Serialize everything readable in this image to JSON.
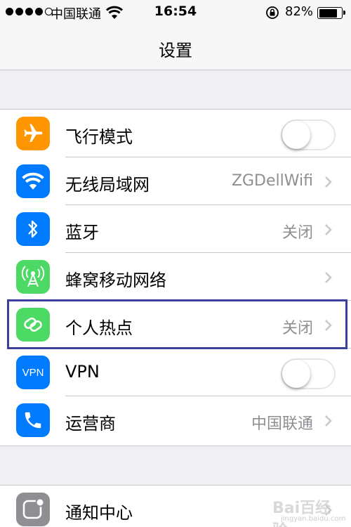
{
  "status": {
    "carrier": "中国联通",
    "time": "16:54",
    "battery_percent": "82%",
    "battery_level": 0.82
  },
  "nav": {
    "title": "设置"
  },
  "rows": [
    {
      "label": "飞行模式",
      "icon": "airplane-icon",
      "color": "#ff9500",
      "control": "toggle",
      "on": false
    },
    {
      "label": "无线局域网",
      "icon": "wifi-icon",
      "color": "#007aff",
      "value": "ZGDellWifi",
      "control": "chevron"
    },
    {
      "label": "蓝牙",
      "icon": "bluetooth-icon",
      "color": "#007aff",
      "value": "关闭",
      "control": "chevron"
    },
    {
      "label": "蜂窝移动网络",
      "icon": "cellular-antenna-icon",
      "color": "#4cd964",
      "control": "chevron"
    },
    {
      "label": "个人热点",
      "icon": "hotspot-chain-icon",
      "color": "#4cd964",
      "value": "关闭",
      "control": "chevron"
    },
    {
      "label": "VPN",
      "icon": "vpn-icon",
      "color": "#007aff",
      "icon_text": "VPN",
      "control": "toggle",
      "on": false
    },
    {
      "label": "运营商",
      "icon": "phone-icon",
      "color": "#007aff",
      "value": "中国联通",
      "control": "chevron"
    },
    {
      "label": "通知中心",
      "icon": "notification-center-icon",
      "color": "#8e8e93",
      "control": "chevron"
    }
  ],
  "watermark": {
    "text": "Bai百经验",
    "sub": "jingyan.baidu.com"
  }
}
